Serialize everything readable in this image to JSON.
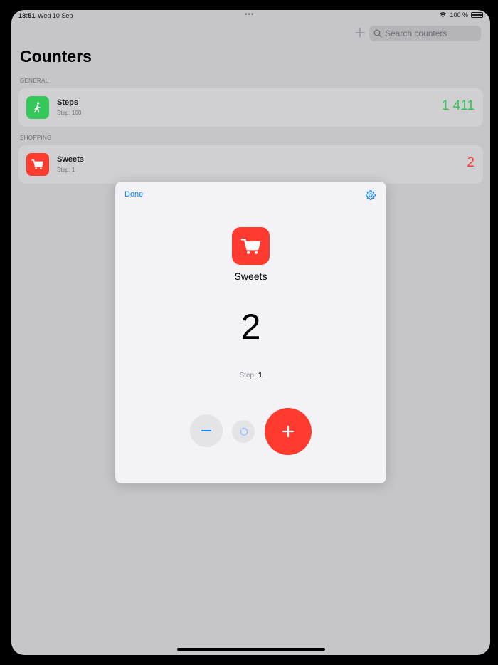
{
  "status_bar": {
    "time": "18:51",
    "date": "Wed 10 Sep",
    "dots": "•••",
    "battery_text": "100 %"
  },
  "toolbar": {
    "add_icon": "plus-icon",
    "search_placeholder": "Search counters"
  },
  "page": {
    "title": "Counters"
  },
  "sections": [
    {
      "header": "GENERAL",
      "items": [
        {
          "title": "Steps",
          "subtitle": "Step: 100",
          "value": "1 411",
          "icon": "walking-person-icon",
          "color": "#34c759"
        }
      ]
    },
    {
      "header": "SHOPPING",
      "items": [
        {
          "title": "Sweets",
          "subtitle": "Step: 1",
          "value": "2",
          "icon": "shopping-cart-icon",
          "color": "#ff3b30"
        }
      ]
    }
  ],
  "modal": {
    "done_label": "Done",
    "settings_icon": "gear-icon",
    "counter_icon": "shopping-cart-icon",
    "title": "Sweets",
    "value": "2",
    "step_label": "Step",
    "step_value": "1",
    "decrement_label": "−",
    "increment_label": "+",
    "reset_icon": "reset-icon",
    "accent_color": "#ff3b30"
  },
  "colors": {
    "accent_blue": "#0a84ff",
    "green": "#34c759",
    "red": "#ff3b30"
  }
}
